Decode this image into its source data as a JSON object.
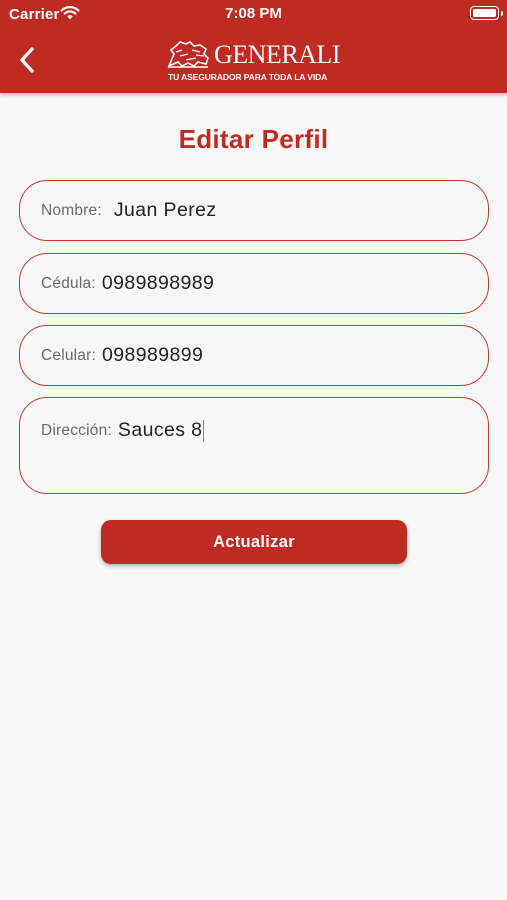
{
  "status_bar": {
    "carrier": "Carrier",
    "time": "7:08 PM"
  },
  "header": {
    "brand": "GENERALI",
    "tagline": "TU ASEGURADOR PARA TODA LA VIDA",
    "back_icon": "chevron-left-icon",
    "background_color": "#bf2a22"
  },
  "page": {
    "title": "Editar Perfil"
  },
  "form": {
    "nombre": {
      "label": "Nombre:",
      "value": "Juan Perez"
    },
    "cedula": {
      "label": "Cédula:",
      "value": "0989898989"
    },
    "celular": {
      "label": "Celular:",
      "value": "098989899"
    },
    "direccion": {
      "label": "Dirección:",
      "value": "Sauces 8"
    }
  },
  "actions": {
    "submit_label": "Actualizar"
  },
  "colors": {
    "accent": "#bf2a22",
    "field_border": "#c0392b",
    "background": "#f8f8f8"
  }
}
